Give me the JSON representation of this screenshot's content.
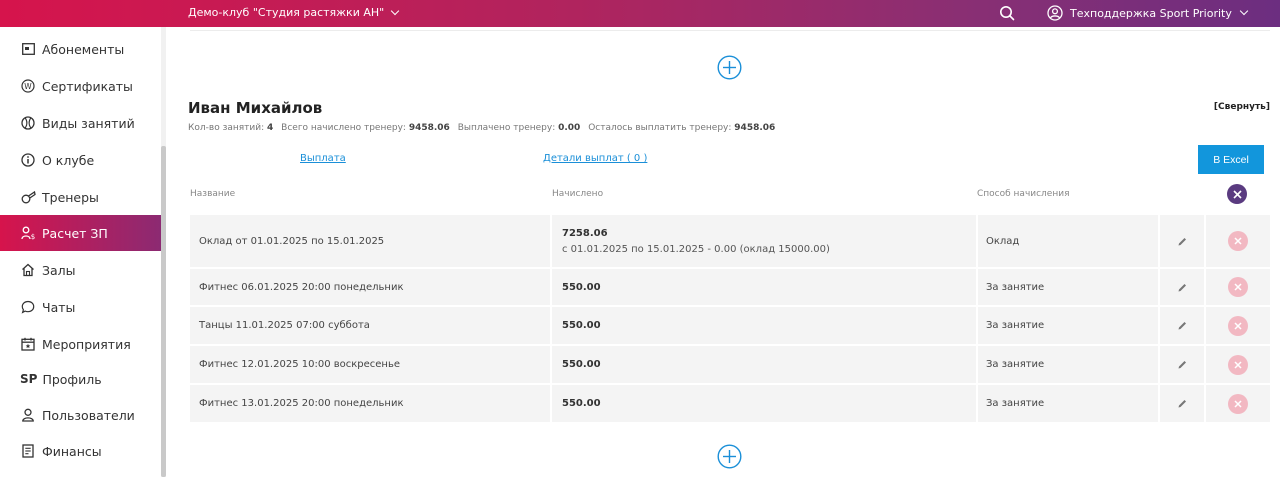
{
  "topbar": {
    "club_label": "Демо-клуб \"Студия растяжки АН\"",
    "user_label": "Техподдержка Sport Priority"
  },
  "sidebar": {
    "items": [
      {
        "label": "Абонементы",
        "icon": "card-icon"
      },
      {
        "label": "Сертификаты",
        "icon": "certificate-icon"
      },
      {
        "label": "Виды занятий",
        "icon": "ball-icon"
      },
      {
        "label": "О клубе",
        "icon": "info-icon"
      },
      {
        "label": "Тренеры",
        "icon": "whistle-icon"
      },
      {
        "label": "Расчет ЗП",
        "icon": "salary-icon",
        "active": true
      },
      {
        "label": "Залы",
        "icon": "home-icon"
      },
      {
        "label": "Чаты",
        "icon": "chat-icon"
      },
      {
        "label": "Мероприятия",
        "icon": "calendar-icon"
      },
      {
        "label": "Профиль",
        "icon": "sp-logo",
        "prefix": "SP"
      },
      {
        "label": "Пользователи",
        "icon": "user-icon"
      },
      {
        "label": "Финансы",
        "icon": "document-icon"
      }
    ]
  },
  "trainer": {
    "name": "Иван Михайлов",
    "collapse_label": "[Свернуть]",
    "stats": {
      "sessions_label": "Кол-во занятий:",
      "sessions_value": "4",
      "accrued_label": "Всего начислено тренеру:",
      "accrued_value": "9458.06",
      "paid_label": "Выплачено тренеру:",
      "paid_value": "0.00",
      "remaining_label": "Осталось выплатить тренеру:",
      "remaining_value": "9458.06"
    },
    "payout_link": "Выплата",
    "payout_details_link": "Детали выплат ( 0 )",
    "excel_button": "В Excel"
  },
  "table": {
    "headers": {
      "name": "Название",
      "accrued": "Начислено",
      "method": "Способ начисления"
    },
    "rows": [
      {
        "name": "Оклад от 01.01.2025 по 15.01.2025",
        "value": "7258.06",
        "detail": "с 01.01.2025 по 15.01.2025 - 0.00 (оклад 15000.00)",
        "method": "Оклад"
      },
      {
        "name": "Фитнес 06.01.2025 20:00 понедельник",
        "value": "550.00",
        "detail": "",
        "method": "За занятие"
      },
      {
        "name": "Танцы 11.01.2025 07:00 суббота",
        "value": "550.00",
        "detail": "",
        "method": "За занятие"
      },
      {
        "name": "Фитнес 12.01.2025 10:00 воскресенье",
        "value": "550.00",
        "detail": "",
        "method": "За занятие"
      },
      {
        "name": "Фитнес 13.01.2025 20:00 понедельник",
        "value": "550.00",
        "detail": "",
        "method": "За занятие"
      }
    ]
  },
  "colors": {
    "accent_pink": "#d6144c",
    "accent_purple": "#6c2e80",
    "link_blue": "#1a8fd8",
    "excel_blue": "#1296dc",
    "delete_pink": "#f2b8c2"
  }
}
